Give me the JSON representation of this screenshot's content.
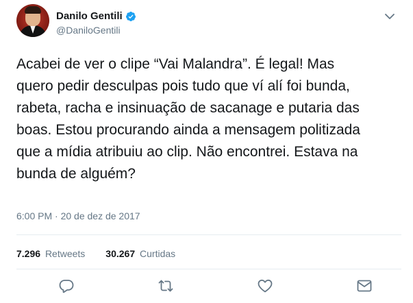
{
  "tweet": {
    "author": {
      "display_name": "Danilo Gentili",
      "handle": "@DaniloGentili",
      "verified": true
    },
    "text": "Acabei de ver o clipe “Vai Malandra”. É legal! Mas\nquero pedir desculpas pois tudo que ví alí foi bunda,\nrabeta, racha e insinuação de sacanage e putaria das\nboas. Estou procurando ainda a mensagem politizada\nque a mídia atribuiu ao clip. Não encontrei. Estava na\nbunda de alguém?",
    "timestamp": "6:00 PM · 20 de dez de 2017",
    "stats": {
      "retweets_count": "7.296",
      "retweets_label": "Retweets",
      "likes_count": "30.267",
      "likes_label": "Curtidas"
    }
  },
  "icons": {
    "reply": "reply-icon",
    "retweet": "retweet-icon",
    "like": "heart-icon",
    "dm": "envelope-icon",
    "more": "chevron-down-icon",
    "verified": "verified-badge-icon"
  },
  "colors": {
    "text": "#14171a",
    "secondary": "#657786",
    "divider": "#e6ecf0",
    "verified": "#1da1f2"
  }
}
